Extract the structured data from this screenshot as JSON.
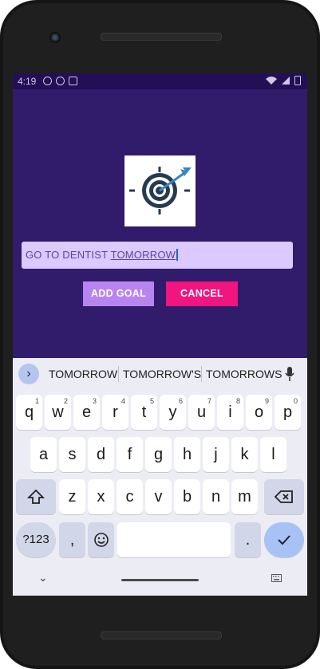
{
  "status": {
    "time": "4:19"
  },
  "app": {
    "input_text_plain": "GO TO DENTIST ",
    "input_text_underlined": "TOMORROW",
    "add_label": "ADD GOAL",
    "cancel_label": "CANCEL"
  },
  "keyboard": {
    "suggestions": [
      "TOMORROW",
      "TOMORROW'S",
      "TOMORROWS"
    ],
    "row1": [
      {
        "k": "q",
        "n": "1"
      },
      {
        "k": "w",
        "n": "2"
      },
      {
        "k": "e",
        "n": "3"
      },
      {
        "k": "r",
        "n": "4"
      },
      {
        "k": "t",
        "n": "5"
      },
      {
        "k": "y",
        "n": "6"
      },
      {
        "k": "u",
        "n": "7"
      },
      {
        "k": "i",
        "n": "8"
      },
      {
        "k": "o",
        "n": "9"
      },
      {
        "k": "p",
        "n": "0"
      }
    ],
    "row2": [
      "a",
      "s",
      "d",
      "f",
      "g",
      "h",
      "j",
      "k",
      "l"
    ],
    "row3": [
      "z",
      "x",
      "c",
      "v",
      "b",
      "n",
      "m"
    ],
    "symbols_label": "?123",
    "comma_label": ",",
    "period_label": "."
  },
  "colors": {
    "background": "#311b6b",
    "add_button": "#b784f0",
    "cancel_button": "#f0157f",
    "input_bg": "#dcc9ff"
  }
}
